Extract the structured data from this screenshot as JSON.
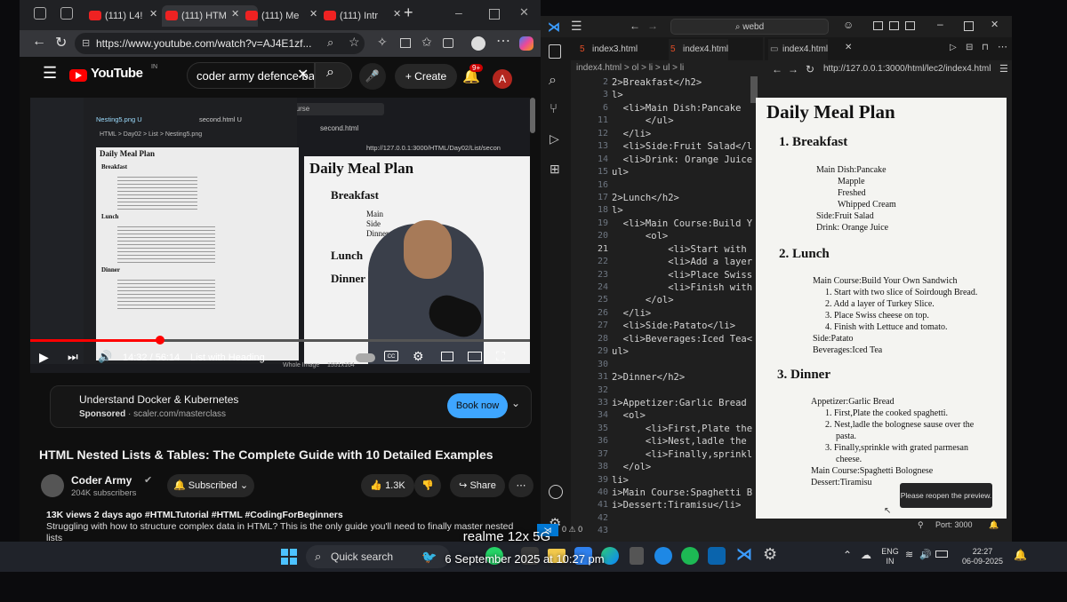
{
  "browser": {
    "tabs": [
      {
        "label": "(111) L4!"
      },
      {
        "label": "(111) HTM"
      },
      {
        "label": "(111) Me"
      },
      {
        "label": "(111) Intr"
      }
    ],
    "url": "https://www.youtube.com/watch?v=AJ4E1zf..."
  },
  "youtube": {
    "logo_text": "YouTube",
    "logo_region": "IN",
    "search_value": "coder army defence bat",
    "create_label": "Create",
    "notif_count": "9+",
    "avatar_letter": "A"
  },
  "video": {
    "inner_tab1": "Nesting5.png U",
    "inner_tab2": "second.html U",
    "inner_crumb": "HTML > Day02 > List > Nesting5.png",
    "inner_search": "mern-stack-course",
    "inner_preview_tab": "second.html",
    "inner_preview_url": "http://127.0.0.1:3000/HTML/Day02/List/secon",
    "thumb_title": "Daily Meal Plan",
    "thumb_h2": [
      "Breakfast",
      "Lunch",
      "Dinner"
    ],
    "thumb_items": [
      "Main",
      "Side",
      "Dinner"
    ],
    "time": "14:32 / 56:14",
    "chapter": "List with Heading",
    "progress": 0.26,
    "badge": "Whole Image",
    "dims": "1551x164"
  },
  "ad": {
    "title": "Understand Docker & Kubernetes",
    "sponsored": "Sponsored",
    "domain": "scaler.com/masterclass",
    "button": "Book now"
  },
  "meta": {
    "title": "HTML Nested Lists & Tables: The Complete Guide with 10 Detailed Examples",
    "channel": "Coder Army",
    "subs": "204K subscribers",
    "subscribed": "Subscribed",
    "likes": "1.3K",
    "share": "Share",
    "stats": "13K views  2 days ago  #HTMLTutorial #HTML #CodingForBeginners",
    "desc": "Struggling with how to structure complex data in HTML? This is the only guide you'll need to finally master nested lists"
  },
  "vscode": {
    "search": "webd",
    "tabs": [
      "index3.html",
      "index4.html"
    ],
    "breadcrumb": "index4.html > ol > li > ul > li",
    "preview_tab": "index4.html",
    "preview_url": "http://127.0.0.1:3000/html/lec2/index4.html",
    "line_numbers": [
      "2",
      "3",
      "6",
      "11",
      "12",
      "13",
      "14",
      "15",
      "16",
      "17",
      "18",
      "19",
      "20",
      "21",
      "22",
      "23",
      "24",
      "25",
      "26",
      "27",
      "28",
      "29",
      "30",
      "31",
      "32",
      "33",
      "34",
      "35",
      "36",
      "37",
      "38",
      "39",
      "40",
      "41",
      "42",
      "43"
    ],
    "code": [
      "2>Breakfast</h2>",
      "l>",
      "  <li>Main Dish:Pancake",
      "      </ul>",
      "  </li>",
      "  <li>Side:Fruit Salad</l",
      "  <li>Drink: Orange Juice",
      "ul>",
      "",
      "2>Lunch</h2>",
      "l>",
      "  <li>Main Course:Build Y",
      "      <ol>",
      "          <li>Start with",
      "          <li>Add a layer",
      "          <li>Place Swiss",
      "          <li>Finish with",
      "      </ol>",
      "  </li>",
      "  <li>Side:Patato</li>",
      "  <li>Beverages:Iced Tea<",
      "ul>",
      "",
      "2>Dinner</h2>",
      "",
      "i>Appetizer:Garlic Bread",
      "  <ol>",
      "      <li>First,Plate the",
      "      <li>Nest,ladle the",
      "      <li>Finally,sprinkl",
      "  </ol>",
      "li>",
      "i>Main Course:Spaghetti B",
      "i>Dessert:Tiramisu</li>",
      "",
      ""
    ],
    "toast": "Please reopen the preview.",
    "port": "Port: 3000",
    "status_left": "0 ⚠ 0"
  },
  "preview": {
    "title": "Daily Meal Plan",
    "breakfast": {
      "heading": "Breakfast",
      "main": "Main Dish:Pancake",
      "sub": [
        "Mapple",
        "Freshed",
        "Whipped Cream"
      ],
      "side": "Side:Fruit Salad",
      "drink": "Drink: Orange Juice"
    },
    "lunch": {
      "heading": "Lunch",
      "main": "Main Course:Build Your Own Sandwich",
      "steps": [
        "Start with two slice of Soirdough Bread.",
        "Add a layer of Turkey Slice.",
        "Place Swiss cheese on top.",
        "Finish with Lettuce and tomato."
      ],
      "side": "Side:Patato",
      "bev": "Beverages:Iced Tea"
    },
    "dinner": {
      "heading": "Dinner",
      "app": "Appetizer:Garlic Bread",
      "steps": [
        "First,Plate the cooked spaghetti.",
        "Nest,ladle the bolognese sause over the",
        "pasta.",
        "Finally,sprinkle with grated parmesan",
        "cheese."
      ],
      "main": "Main Course:Spaghetti Bolognese",
      "dessert": "Dessert:Tiramisu"
    }
  },
  "taskbar": {
    "search": "Quick search",
    "lang1": "ENG",
    "lang2": "IN",
    "time": "22:27",
    "date": "06-09-2025"
  },
  "watermark": {
    "device": "realme 12x 5G",
    "datetime": "6 September 2025 at 10:27 pm"
  },
  "colors": {
    "youtube_red": "#ff0000",
    "link_blue": "#3ea6ff",
    "vscode_bg": "#1f1f1f"
  }
}
